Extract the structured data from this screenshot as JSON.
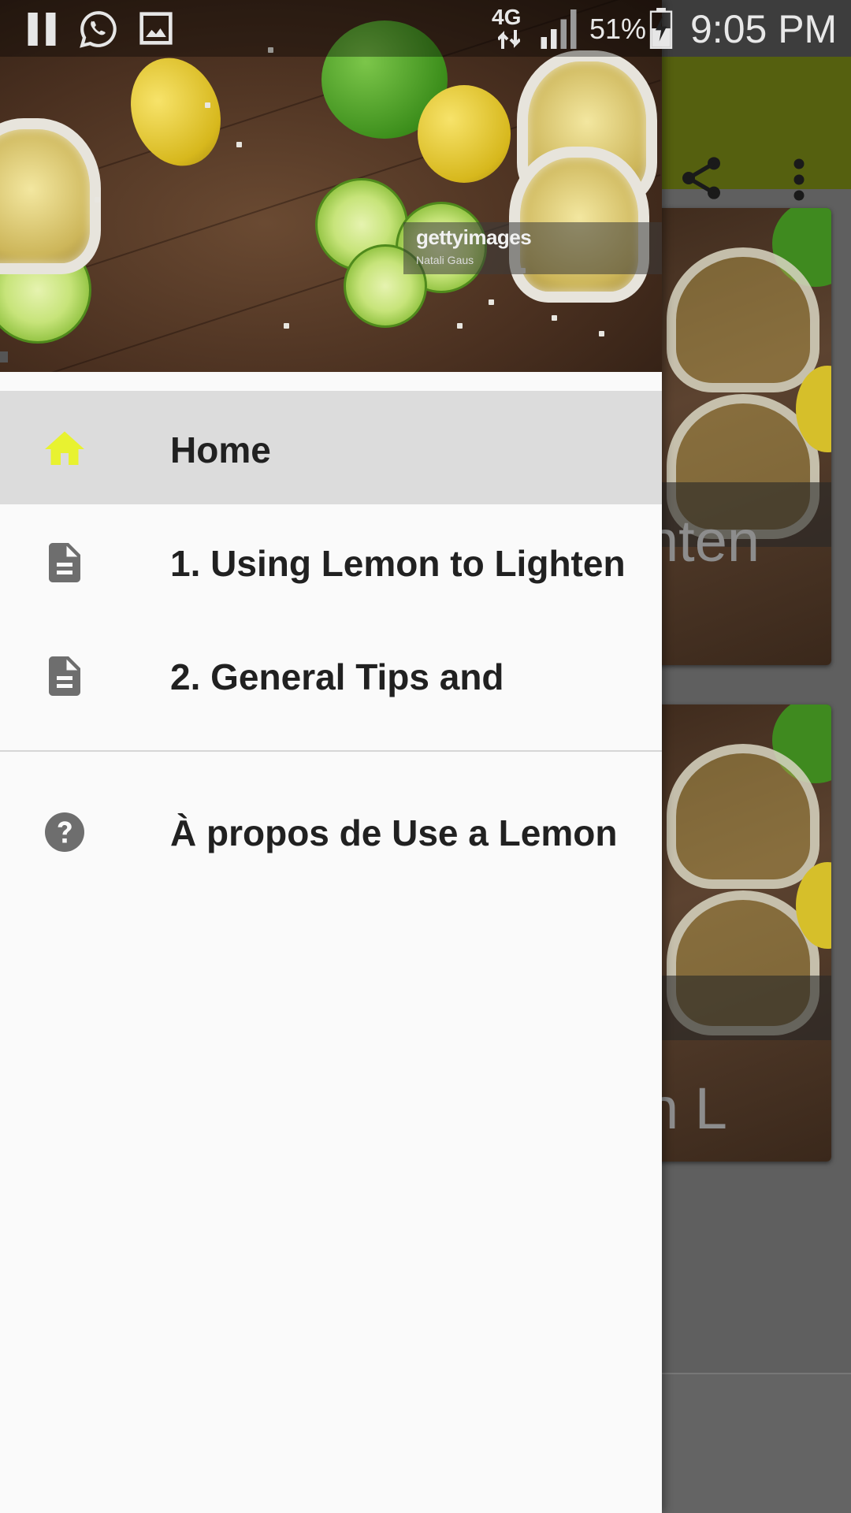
{
  "status_bar": {
    "network": "4G",
    "battery": "51%",
    "time": "9:05 PM",
    "icons": [
      "pause-icon",
      "whatsapp-icon",
      "gallery-icon",
      "network-arrows-icon",
      "signal-icon",
      "battery-charging-icon"
    ]
  },
  "drawer": {
    "header_image": {
      "watermark_logo": "gettyimages",
      "watermark_credit": "Natali Gaus"
    },
    "items": [
      {
        "label": "Home",
        "icon": "home-icon",
        "active": true
      },
      {
        "label": "1. Using Lemon to Lighten",
        "icon": "document-icon",
        "active": false
      },
      {
        "label": "2. General Tips and",
        "icon": "document-icon",
        "active": false
      }
    ],
    "about": {
      "label": "À propos de Use a Lemon",
      "icon": "help-icon"
    }
  },
  "background_app": {
    "toolbar_color": "#55600f",
    "toolbar_actions": [
      "share-icon",
      "more-vert-icon"
    ],
    "cards": [
      {
        "caption": "nten"
      },
      {
        "caption": "n L"
      }
    ]
  },
  "colors": {
    "accent_home_icon": "#e8f230",
    "drawer_bg": "#fafafa",
    "active_row": "#dcdcdc"
  }
}
